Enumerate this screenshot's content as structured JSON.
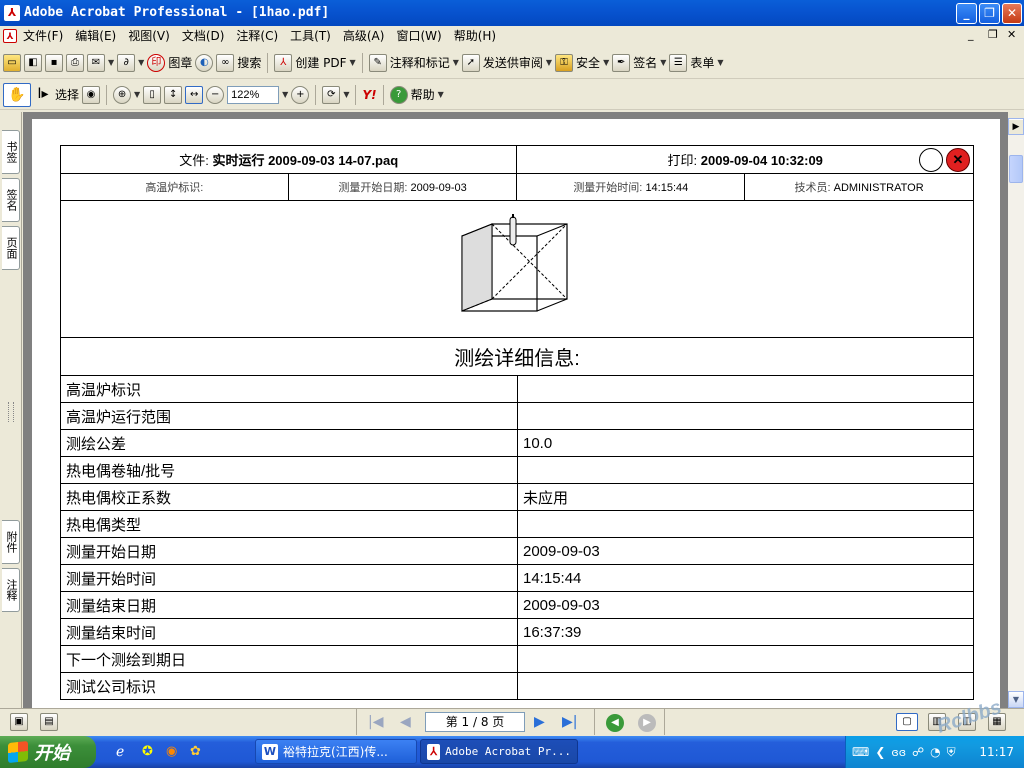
{
  "window": {
    "title": "Adobe Acrobat Professional - [1hao.pdf]",
    "app_icon": "pdf-icon"
  },
  "menu": [
    "文件(F)",
    "编辑(E)",
    "视图(V)",
    "文档(D)",
    "注释(C)",
    "工具(T)",
    "高级(A)",
    "窗口(W)",
    "帮助(H)"
  ],
  "toolbar1": {
    "stamp_label": "图章",
    "search_label": "搜索",
    "create_pdf_label": "创建 PDF",
    "comment_label": "注释和标记",
    "send_review_label": "发送供审阅",
    "security_label": "安全",
    "sign_label": "签名",
    "forms_label": "表单"
  },
  "toolbar2": {
    "select_label": "选择",
    "zoom_value": "122%",
    "help_label": "帮助",
    "yahoo_label": "Y!"
  },
  "left_tabs": {
    "bookmarks": "书签",
    "signatures": "签名",
    "pages": "页面",
    "attachments": "附件",
    "comments": "注释"
  },
  "document": {
    "file_label": "文件: ",
    "file_value": "实时运行 2009-09-03 14-07.paq",
    "print_label": "打印: ",
    "print_value": "2009-09-04 10:32:09",
    "furnace_id_label": "高温炉标识:",
    "start_date_label": "测量开始日期: ",
    "start_date_value": "2009-09-03",
    "start_time_label": "测量开始时间: ",
    "start_time_value": "14:15:44",
    "technician_label": "技术员: ",
    "technician_value": "ADMINISTRATOR",
    "section_title": "测绘详细信息:",
    "rows": [
      {
        "label": "高温炉标识",
        "value": ""
      },
      {
        "label": "高温炉运行范围",
        "value": ""
      },
      {
        "label": "测绘公差",
        "value": "10.0"
      },
      {
        "label": "热电偶卷轴/批号",
        "value": ""
      },
      {
        "label": "热电偶校正系数",
        "value": "未应用"
      },
      {
        "label": "热电偶类型",
        "value": ""
      },
      {
        "label": "测量开始日期",
        "value": "2009-09-03"
      },
      {
        "label": "测量开始时间",
        "value": "14:15:44"
      },
      {
        "label": "测量结束日期",
        "value": "2009-09-03"
      },
      {
        "label": "测量结束时间",
        "value": "16:37:39"
      },
      {
        "label": "下一个测绘到期日",
        "value": ""
      },
      {
        "label": "测试公司标识",
        "value": ""
      }
    ]
  },
  "navigation": {
    "page_indicator": "第 1 / 8 页"
  },
  "taskbar": {
    "start_label": "开始",
    "tasks": [
      "裕特拉克(江西)传...",
      "Adobe Acrobat Pr..."
    ],
    "clock": "11:17",
    "watermark": "Rclbbs"
  },
  "colors": {
    "titlebar": "#0a5fd8",
    "close_red": "#e02020",
    "taskbar": "#245edb",
    "start_green": "#3c8f3a"
  }
}
